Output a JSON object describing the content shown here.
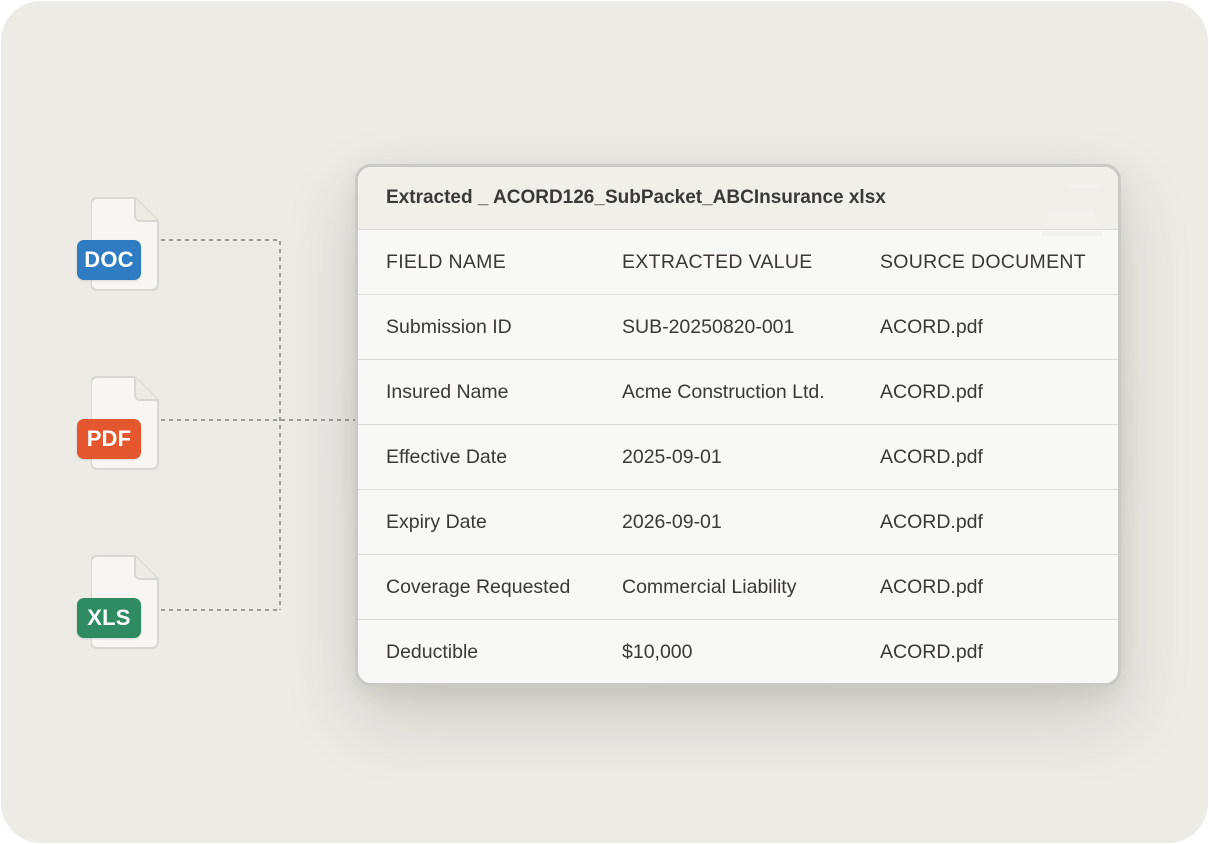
{
  "colors": {
    "doc": "#2f7cc3",
    "pdf": "#e4572e",
    "xls": "#2e8b62",
    "background": "#ecebe6",
    "card": "#f8f8f6"
  },
  "files": [
    {
      "label": "DOC",
      "icon": "file-icon"
    },
    {
      "label": "PDF",
      "icon": "file-icon"
    },
    {
      "label": "XLS",
      "icon": "file-icon"
    }
  ],
  "table": {
    "title": "Extracted _ ACORD126_SubPacket_ABCInsurance xlsx",
    "columns": [
      "FIELD NAME",
      "EXTRACTED VALUE",
      "SOURCE DOCUMENT"
    ],
    "rows": [
      [
        "Submission ID",
        "SUB-20250820-001",
        "ACORD.pdf"
      ],
      [
        "Insured Name",
        "Acme Construction Ltd.",
        "ACORD.pdf"
      ],
      [
        "Effective Date",
        "2025-09-01",
        "ACORD.pdf"
      ],
      [
        "Expiry Date",
        "2026-09-01",
        "ACORD.pdf"
      ],
      [
        "Coverage Requested",
        "Commercial Liability",
        "ACORD.pdf"
      ],
      [
        "Deductible",
        "$10,000",
        "ACORD.pdf"
      ]
    ]
  }
}
